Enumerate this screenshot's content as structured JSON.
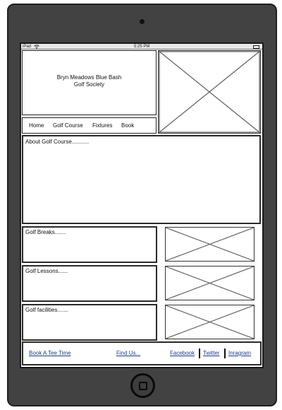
{
  "device": {
    "name": "iPad"
  },
  "status_bar": {
    "carrier": "iPad",
    "time": "5:25 PM",
    "wifi_icon": "wifi-icon",
    "battery_icon": "battery-icon"
  },
  "header": {
    "title_line1": "Bryn Meadows Blue Bash",
    "title_line2": "Golf Society"
  },
  "nav": {
    "items": [
      "Home",
      "Golf Course",
      "Fixtures",
      "Book"
    ]
  },
  "about": {
    "text": "About Golf Course..........."
  },
  "sections": [
    {
      "text": "Golf Breaks......."
    },
    {
      "text": "Golf Lessons......"
    },
    {
      "text": "Golf facilities......."
    }
  ],
  "footer": {
    "book_link": "Book A Tee Time",
    "find_link": "Find Us...",
    "social": [
      "Facebook",
      "Twitter",
      "Inragram"
    ]
  }
}
